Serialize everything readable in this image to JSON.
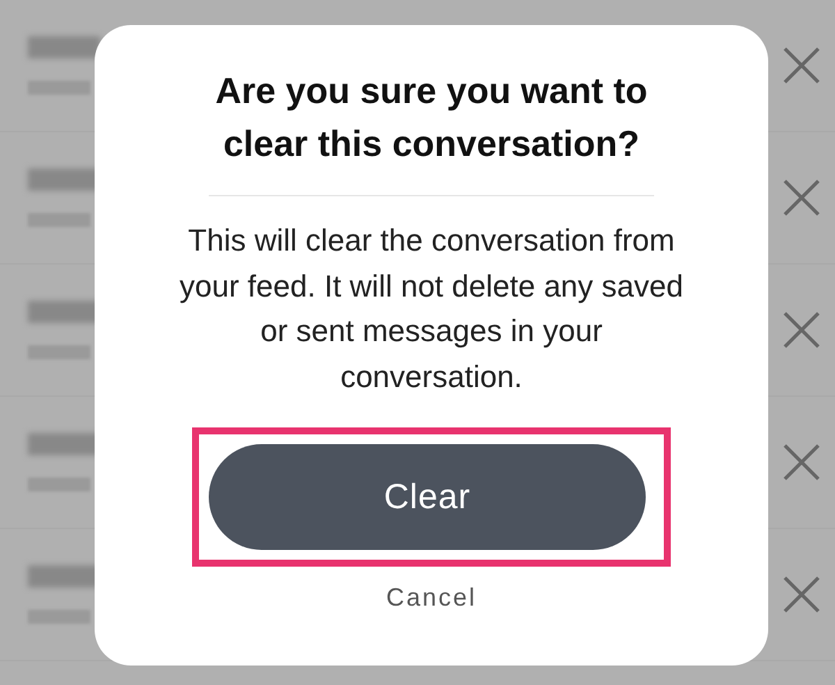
{
  "dialog": {
    "title": "Are you sure you want to clear this conversation?",
    "message": "This will clear the conversation from your feed. It will not delete any saved or sent messages in your conversation.",
    "primary_button": {
      "label": "Clear",
      "highlighted": true
    },
    "cancel_button": {
      "label": "Cancel"
    }
  }
}
